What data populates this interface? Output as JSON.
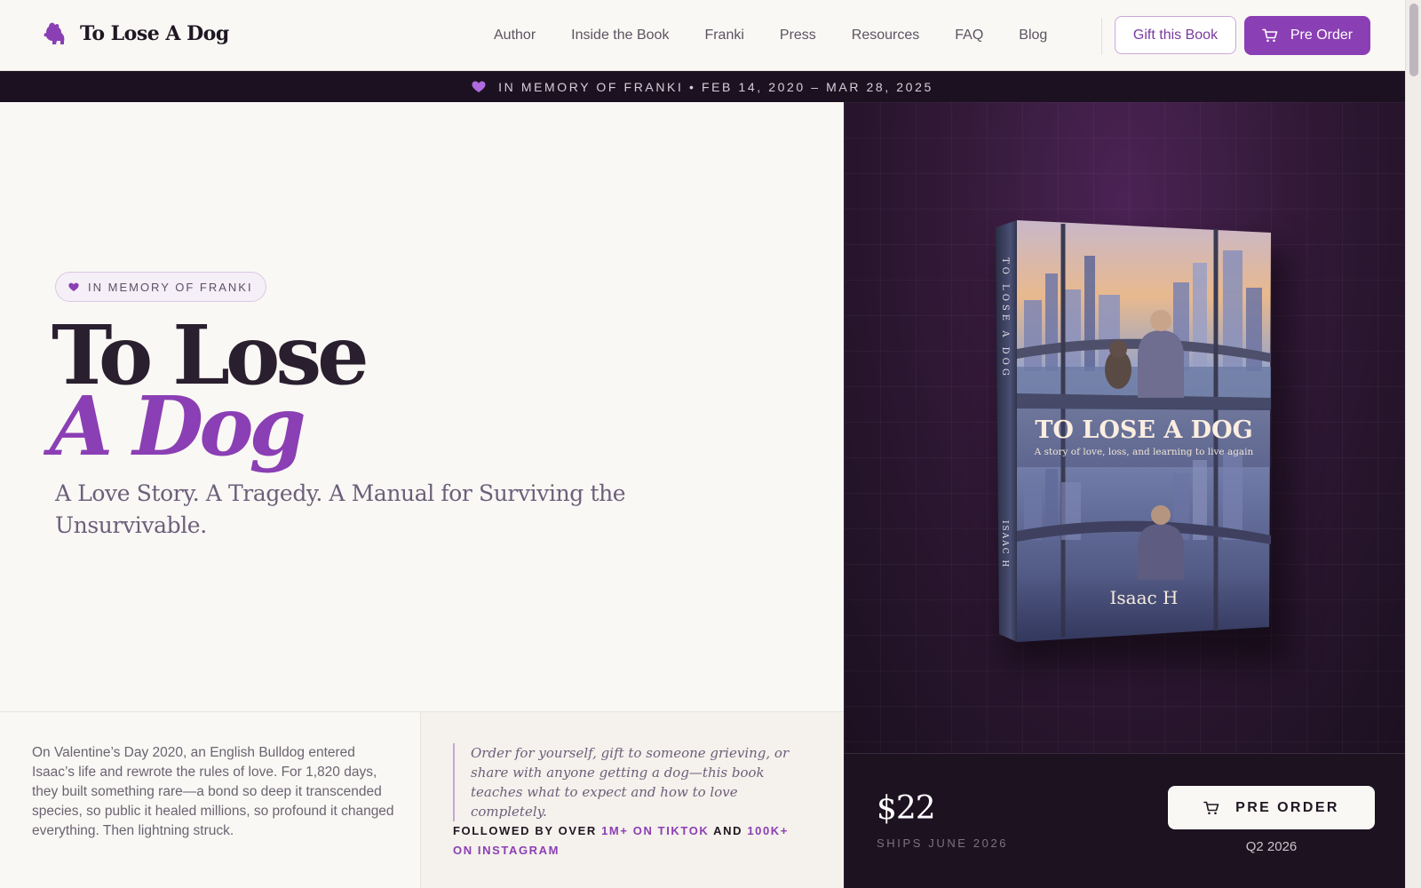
{
  "header": {
    "brand_name": "To Lose A Dog",
    "nav": [
      "Author",
      "Inside the Book",
      "Franki",
      "Press",
      "Resources",
      "FAQ",
      "Blog"
    ],
    "gift_label": "Gift this Book",
    "preorder_label": "Pre Order"
  },
  "memorial_bar": {
    "text": "IN MEMORY OF FRANKI • FEB 14, 2020 – MAR 28, 2025"
  },
  "hero": {
    "pill": "IN MEMORY OF FRANKI",
    "title_line1": "To Lose",
    "title_line2": "A Dog",
    "subtitle": "A Love Story. A Tragedy. A Manual for Surviving the Unsurvivable."
  },
  "story": {
    "text": "On Valentine’s Day 2020, an English Bulldog entered Isaac’s life and rewrote the rules of love. For 1,820 days, they built something rare—a bond so deep it transcended species, so public it healed millions, so profound it changed everything. Then lightning struck."
  },
  "quote": {
    "text": "Order for yourself, gift to someone grieving, or share with anyone getting a dog—this book teaches what to expect and how to love completely."
  },
  "followers": {
    "prefix": "FOLLOWED BY OVER ",
    "tiktok": "1M+ ON TIKTOK",
    "mid": " AND ",
    "instagram": "100K+ ON INSTAGRAM"
  },
  "book": {
    "cover_title": "TO LOSE A DOG",
    "cover_tagline": "A story of love, loss, and learning to live again",
    "author": "Isaac H",
    "spine_title": "TO LOSE A DOG",
    "spine_author": "ISAAC H"
  },
  "purchase": {
    "price": "$22",
    "ships": "SHIPS JUNE 2026",
    "button_label": "PRE ORDER",
    "quarter": "Q2 2026"
  },
  "colors": {
    "accent": "#8b3fb4",
    "dark": "#1c1120",
    "cream": "#faf8f5"
  },
  "icons": {
    "brand": "dog-icon",
    "cart": "cart-icon",
    "heart": "heart-icon"
  }
}
